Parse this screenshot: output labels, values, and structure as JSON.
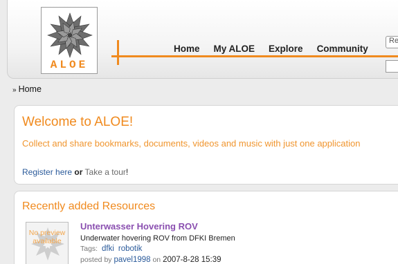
{
  "logo": {
    "text": "ALOE"
  },
  "nav": {
    "items": [
      {
        "label": "Home"
      },
      {
        "label": "My ALOE"
      },
      {
        "label": "Explore"
      },
      {
        "label": "Community"
      }
    ]
  },
  "login": {
    "field1_value": "Re"
  },
  "breadcrumb": {
    "label": "Home"
  },
  "welcome": {
    "title": "Welcome to ALOE!",
    "tagline": "Collect and share bookmarks, documents, videos and music with just one application",
    "register_label": "Register here",
    "or_label": "or",
    "tour_label": "Take a tour",
    "exclamation": "!"
  },
  "recent": {
    "title": "Recently added Resources",
    "items": [
      {
        "thumb_text": "No preview available",
        "title": "Unterwasser Hovering ROV",
        "description": "Underwater hovering ROV from DFKI Bremen",
        "tags_label": "Tags:",
        "tags": [
          "dfki",
          "robotik"
        ],
        "posted_by_label": "posted by",
        "author": "pavel1998",
        "on_label": "on",
        "date": "2007-8-28 15:39"
      }
    ]
  },
  "colors": {
    "accent": "#f08a1e",
    "link": "#2a5a9a",
    "title_link": "#8a4fb0"
  }
}
